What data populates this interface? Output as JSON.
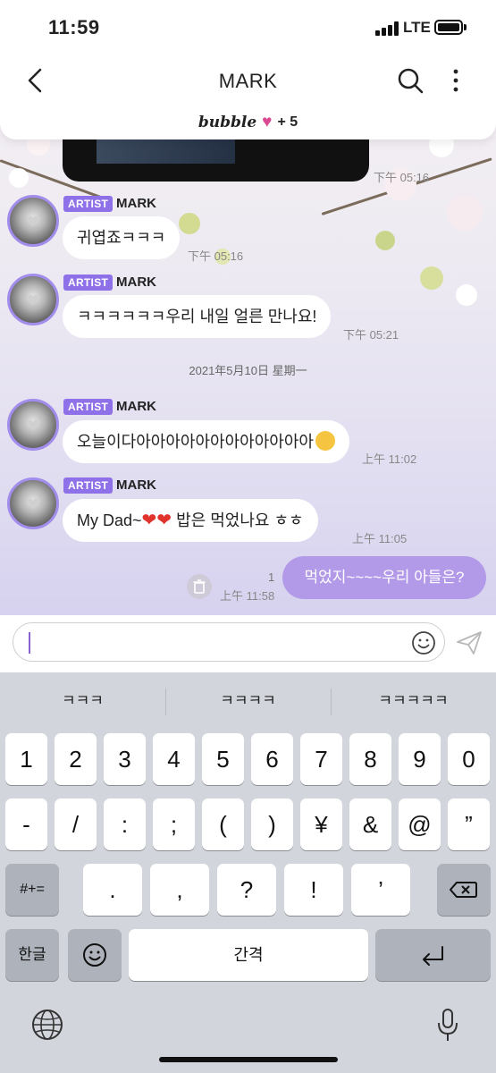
{
  "status_bar": {
    "time": "11:59",
    "network": "LTE"
  },
  "header": {
    "title": "MARK"
  },
  "banner": {
    "word": "bubble",
    "plus": "+ 5"
  },
  "messages": [
    {
      "badge": "ARTIST",
      "sender": "MARK",
      "text": "귀엽죠ㅋㅋㅋ",
      "time": "下午 05:16"
    },
    {
      "badge": "ARTIST",
      "sender": "MARK",
      "text": "ㅋㅋㅋㅋㅋㅋ우리 내일 얼른 만나요!",
      "time": "下午 05:21"
    },
    {
      "badge": "ARTIST",
      "sender": "MARK",
      "text": "오늘이다아아아아아아아아아아아아",
      "time": "上午 11:02"
    },
    {
      "badge": "ARTIST",
      "sender": "MARK",
      "text_prefix": "My Dad~",
      "text_suffix": "밥은 먹었나요 ㅎㅎ",
      "time": "上午 11:05"
    }
  ],
  "media_time": "下午 05:16",
  "date_divider": "2021年5月10日 星期一",
  "outgoing": {
    "text": "먹었지~~~~우리 아들은?",
    "time": "上午 11:58",
    "unread": "1"
  },
  "input": {
    "value": ""
  },
  "keyboard": {
    "suggestions": [
      "ㅋㅋㅋ",
      "ㅋㅋㅋㅋ",
      "ㅋㅋㅋㅋㅋ"
    ],
    "row1": [
      "1",
      "2",
      "3",
      "4",
      "5",
      "6",
      "7",
      "8",
      "9",
      "0"
    ],
    "row2": [
      "-",
      "/",
      ":",
      ";",
      "(",
      ")",
      "¥",
      "&",
      "@",
      "”"
    ],
    "row3": [
      "#+=",
      ".",
      ",",
      "?",
      "!",
      "’"
    ],
    "lang_key": "한글",
    "space_key": "간격"
  },
  "colors": {
    "accent": "#8e70e8",
    "outgoing_bubble": "#b29ae9"
  }
}
